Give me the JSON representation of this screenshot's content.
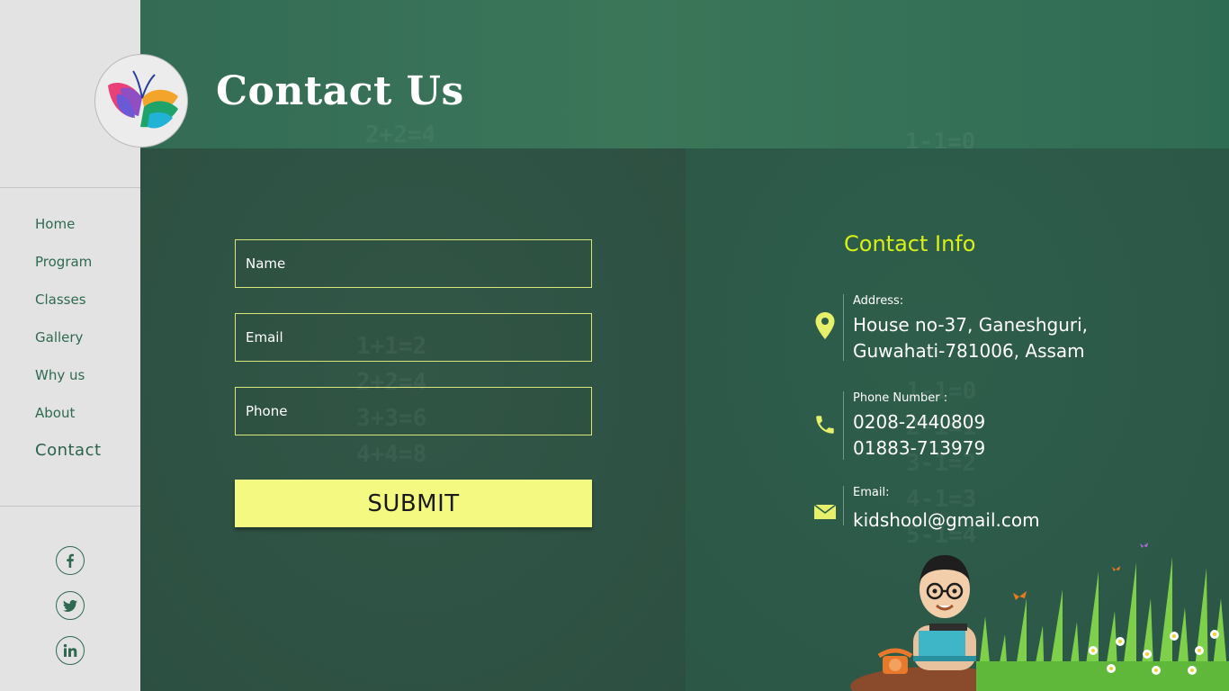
{
  "page": {
    "title": "Contact Us"
  },
  "sidebar": {
    "logo": "butterfly-book-logo",
    "nav": [
      {
        "label": "Home",
        "active": false
      },
      {
        "label": "Program",
        "active": false
      },
      {
        "label": "Classes",
        "active": false
      },
      {
        "label": "Gallery",
        "active": false
      },
      {
        "label": "Why us",
        "active": false
      },
      {
        "label": "About",
        "active": false
      },
      {
        "label": "Contact",
        "active": true
      }
    ],
    "social": [
      "facebook-icon",
      "twitter-icon",
      "linkedin-icon"
    ]
  },
  "form": {
    "name_placeholder": "Name",
    "email_placeholder": "Email",
    "phone_placeholder": "Phone",
    "submit_label": "SUBMIT"
  },
  "contact_info": {
    "title": "Contact Info",
    "address_label": "Address:",
    "address_line1": "House no-37, Ganeshguri,",
    "address_line2": "Guwahati-781006, Assam",
    "phone_label": "Phone Number :",
    "phone1": "0208-2440809",
    "phone2": "01883-713979",
    "email_label": "Email:",
    "email": "kidshool@gmail.com"
  },
  "colors": {
    "accent": "#d8f019",
    "button": "#f4f981",
    "nav_text": "#2f6a50",
    "board": "#2e5446"
  },
  "chalk": {
    "left_top": "2+2=4\n3+3=6\n4+4=8\n5+5=10",
    "left_mid": "1+1=2\n2+2=4\n3+3=6\n4+4=8\n5+5=10",
    "right_top": "1-1=0\n2-1=1\n3-1=2\n4-1=3\n5-1=4",
    "right_mid": "1-1=0\n2-1=1\n3-1=2\n4-1=3\n5-1=4"
  }
}
